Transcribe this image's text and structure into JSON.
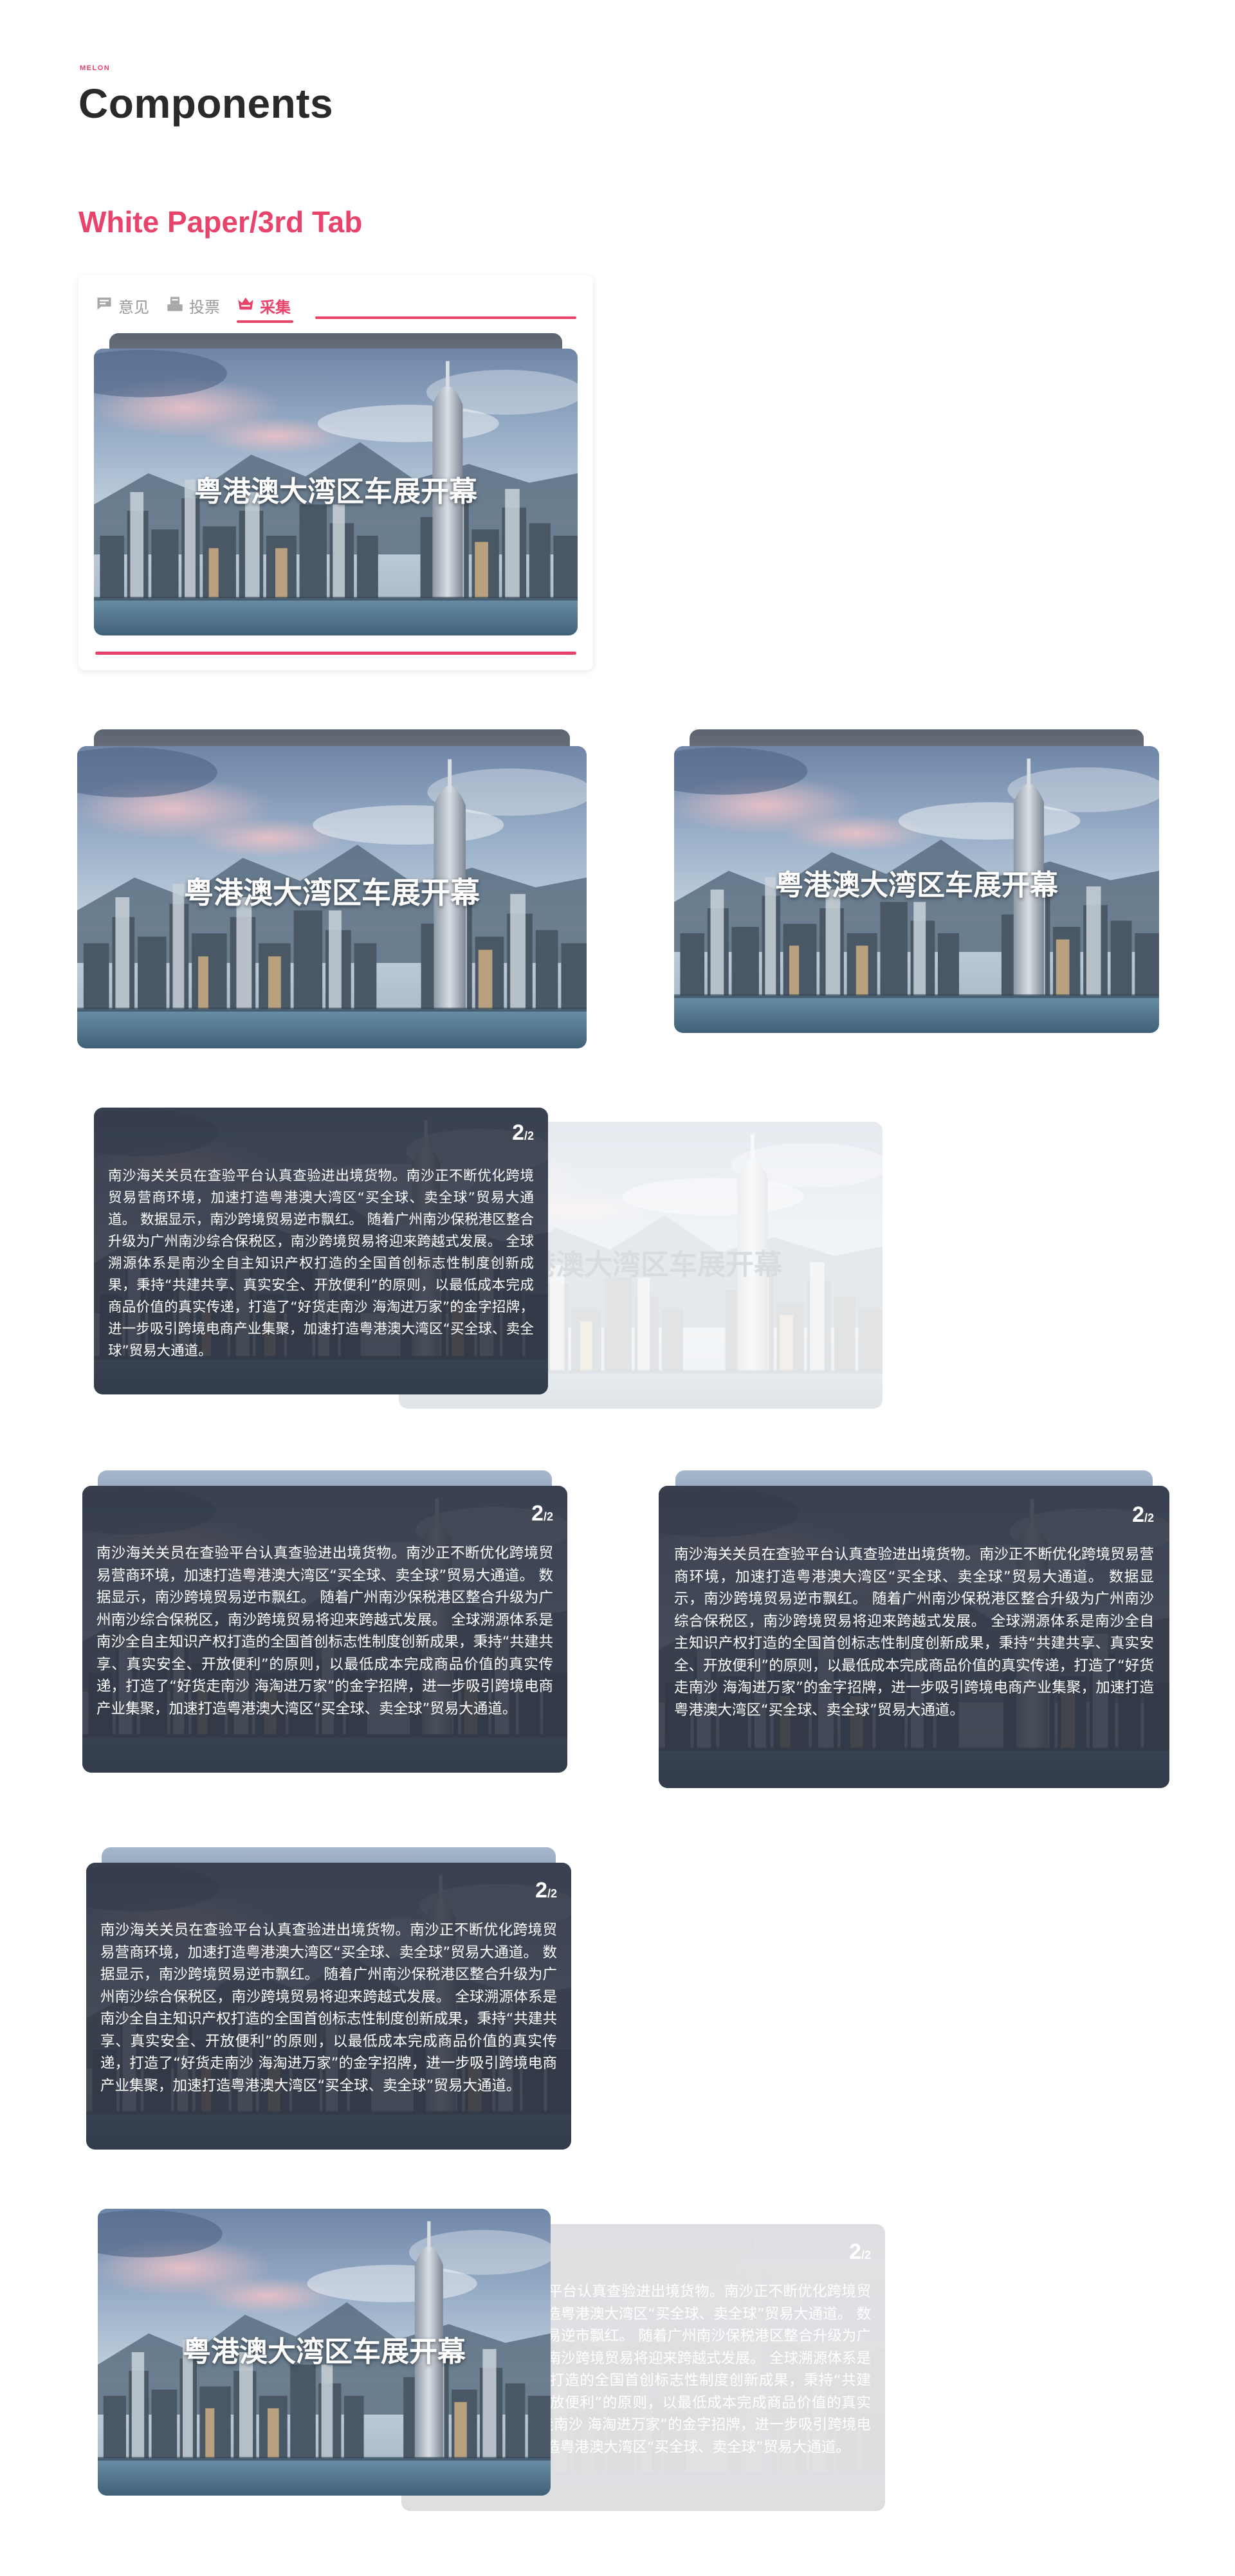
{
  "brand": "MELON",
  "page_title": "Components",
  "section_title": "White Paper/3rd Tab",
  "tabs": [
    {
      "label": "意见",
      "icon": "chat-icon",
      "active": false
    },
    {
      "label": "投票",
      "icon": "vote-box-icon",
      "active": false
    },
    {
      "label": "采集",
      "icon": "crown-basket-icon",
      "active": true
    }
  ],
  "card": {
    "headline": "粤港澳大湾区车展开幕",
    "page_current": "2",
    "page_total": "/2",
    "body": "南沙海关关员在查验平台认真查验进出境货物。南沙正不断优化跨境贸易营商环境，加速打造粤港澳大湾区“买全球、卖全球”贸易大通道。        数据显示，南沙跨境贸易逆市飘红。        随着广州南沙保税港区整合升级为广州南沙综合保税区，南沙跨境贸易将迎来跨越式发展。        全球溯源体系是南沙全自主知识产权打造的全国首创标志性制度创新成果，秉持“共建共享、真实安全、开放便利”的原则，以最低成本完成商品价值的真实传递，打造了“好货走南沙 海淘进万家”的金字招牌，进一步吸引跨境电商产业集聚，加速打造粤港澳大湾区“买全球、卖全球”贸易大通道。"
  },
  "colors": {
    "accent": "#e8436a",
    "title": "#2a2a2a",
    "overlay": "#303642",
    "stack_back": "#5b6470"
  }
}
